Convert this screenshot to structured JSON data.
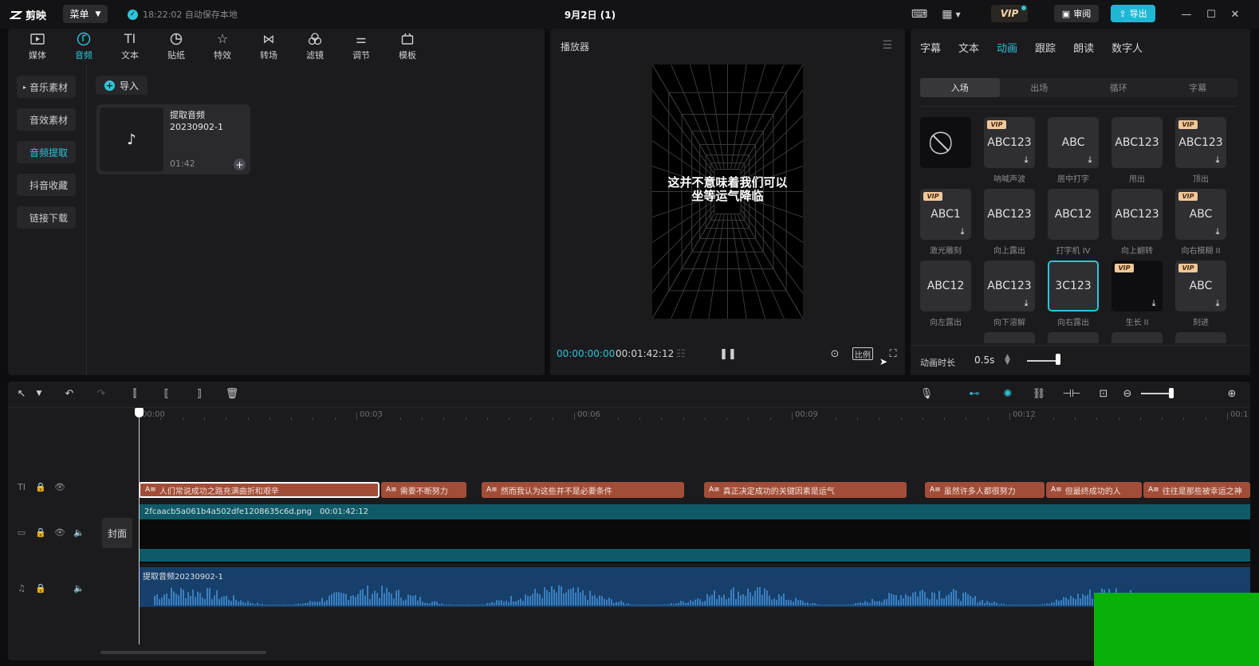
{
  "app": {
    "logo_text": "剪映",
    "menu_label": "菜单",
    "autosave": "18:22:02 自动保存本地",
    "project_title": "9月2日 (1)",
    "vip_label": "VIP",
    "review_label": "审阅",
    "export_label": "导出"
  },
  "media_tabs": [
    {
      "label": "媒体"
    },
    {
      "label": "音频"
    },
    {
      "label": "文本"
    },
    {
      "label": "贴纸"
    },
    {
      "label": "特效"
    },
    {
      "label": "转场"
    },
    {
      "label": "滤镜"
    },
    {
      "label": "调节"
    },
    {
      "label": "模板"
    }
  ],
  "sidebar": [
    {
      "label": "音乐素材"
    },
    {
      "label": "音效素材"
    },
    {
      "label": "音频提取"
    },
    {
      "label": "抖音收藏"
    },
    {
      "label": "链接下载"
    }
  ],
  "import_label": "导入",
  "audio_card": {
    "name": "提取音频20230902-1",
    "duration": "01:42"
  },
  "player": {
    "title": "播放器",
    "subtitle": "这并不意味着我们可以坐等运气降临",
    "time_current": "00:00:00:00",
    "time_total": "00:01:42:12",
    "ratio_label": "比例"
  },
  "prop_tabs": [
    {
      "label": "字幕"
    },
    {
      "label": "文本"
    },
    {
      "label": "动画"
    },
    {
      "label": "跟踪"
    },
    {
      "label": "朗读"
    },
    {
      "label": "数字人"
    }
  ],
  "anim_subtabs": [
    {
      "label": "入场"
    },
    {
      "label": "出场"
    },
    {
      "label": "循环"
    },
    {
      "label": "字幕"
    }
  ],
  "animations": [
    {
      "thumb": "",
      "label": "",
      "vip": false,
      "dl": false
    },
    {
      "thumb": "ABC123",
      "label": "呐喊声波",
      "vip": true,
      "dl": true
    },
    {
      "thumb": "ABC",
      "label": "居中打字",
      "vip": false,
      "dl": true
    },
    {
      "thumb": "ABC123",
      "label": "甩出",
      "vip": false,
      "dl": false
    },
    {
      "thumb": "ABC123",
      "label": "顶出",
      "vip": true,
      "dl": true
    },
    {
      "thumb": "ABC1",
      "label": "激光雕刻",
      "vip": true,
      "dl": true
    },
    {
      "thumb": "ABC123",
      "label": "向上露出",
      "vip": false,
      "dl": false
    },
    {
      "thumb": "ABC12",
      "label": "打字机 IV",
      "vip": false,
      "dl": false
    },
    {
      "thumb": "ABC123",
      "label": "向上翻转",
      "vip": false,
      "dl": false
    },
    {
      "thumb": "ABC",
      "label": "向右模糊 II",
      "vip": true,
      "dl": true
    },
    {
      "thumb": "ABC12",
      "label": "向左露出",
      "vip": false,
      "dl": false
    },
    {
      "thumb": "ABC123",
      "label": "向下溶解",
      "vip": false,
      "dl": true
    },
    {
      "thumb": "3C123",
      "label": "向右露出",
      "vip": false,
      "dl": false
    },
    {
      "thumb": "",
      "label": "生长 II",
      "vip": true,
      "dl": true
    },
    {
      "thumb": "ABC",
      "label": "刻进",
      "vip": true,
      "dl": true
    }
  ],
  "duration": {
    "label": "动画时长",
    "value": "0.5s"
  },
  "ruler": [
    "00:00",
    "00:03",
    "00:06",
    "00:09",
    "00:12",
    "00:1"
  ],
  "cover_label": "封面",
  "text_clips": [
    {
      "text": "人们常说成功之路充满曲折和艰辛",
      "selected": true
    },
    {
      "text": "需要不断努力",
      "selected": false
    },
    {
      "text": "然而我认为这些并不是必要条件",
      "selected": false
    },
    {
      "text": "真正决定成功的关键因素是运气",
      "selected": false
    },
    {
      "text": "虽然许多人都很努力",
      "selected": false
    },
    {
      "text": "但最终成功的人",
      "selected": false
    },
    {
      "text": "往往是那些被幸运之神",
      "selected": false
    }
  ],
  "video_clip": {
    "name": "2fcaacb5a061b4a502dfe1208635c6d.png",
    "duration": "00:01:42:12"
  },
  "audio_clip": {
    "name": "提取音频20230902-1"
  },
  "colors": {
    "accent": "#2ec4d9",
    "text_clip": "#a24d37",
    "video_clip": "#0f5a68",
    "audio_clip": "#163f6b",
    "overlay": "#0ab00a"
  }
}
